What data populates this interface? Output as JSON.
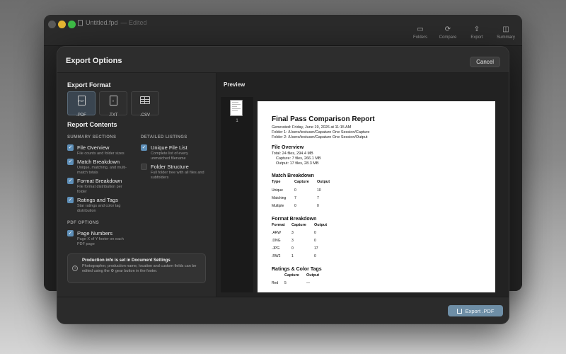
{
  "background_window": {
    "title": "Untitled.fpd",
    "edited": "— Edited",
    "toolbar": [
      {
        "label": "Folders",
        "icon": "folder-icon"
      },
      {
        "label": "Compare",
        "icon": "compare-icon"
      },
      {
        "label": "Export",
        "icon": "share-icon"
      },
      {
        "label": "Summary",
        "icon": "sidebar-icon"
      }
    ]
  },
  "dialog": {
    "title": "Export Options",
    "cancel_label": "Cancel",
    "export_format_heading": "Export Format",
    "formats": [
      {
        "label": ".PDF",
        "selected": true
      },
      {
        "label": ".TXT",
        "selected": false
      },
      {
        "label": ".CSV",
        "selected": false
      }
    ],
    "report_contents_heading": "Report Contents",
    "summary_sections_heading": "SUMMARY SECTIONS",
    "detailed_listings_heading": "DETAILED LISTINGS",
    "summary_sections": [
      {
        "label": "File Overview",
        "desc": "File counts and folder sizes",
        "checked": true
      },
      {
        "label": "Match Breakdown",
        "desc": "Unique, matching, and multi-match totals",
        "checked": true
      },
      {
        "label": "Format Breakdown",
        "desc": "File format distribution per folder",
        "checked": true
      },
      {
        "label": "Ratings and Tags",
        "desc": "Star ratings and color tag distribution",
        "checked": true
      }
    ],
    "detailed_listings": [
      {
        "label": "Unique File List",
        "desc": "Complete list of every unmatched filename",
        "checked": true
      },
      {
        "label": "Folder Structure",
        "desc": "Full folder tree with all files and subfolders",
        "checked": false
      }
    ],
    "pdf_options_heading": "PDF OPTIONS",
    "pdf_options": [
      {
        "label": "Page Numbers",
        "desc": "Page X of Y footer on each PDF page",
        "checked": true
      }
    ],
    "info": {
      "title": "Production info is set in Document Settings",
      "text": "Photographer, production name, location and custom fields can be edited using the ⚙ gear button in the footer."
    },
    "preview_label": "Preview",
    "thumbnail_page": "1",
    "export_label": "Export .PDF"
  },
  "report": {
    "title": "Final Pass Comparison Report",
    "generated": "Generated: Friday, June 19, 2026 at 11:15 AM",
    "folder1": "Folder 1: /Users/testuser/Capature One Session/Capture",
    "folder2": "Folder 2: /Users/testuser/Capature One Session/Output",
    "file_overview_heading": "File Overview",
    "total": "Total: 24 files, 294.4 MB",
    "capture": "Capture: 7 files, 266.1 MB",
    "output": "Output: 17 files, 28.3 MB",
    "match_heading": "Match Breakdown",
    "match_headers": [
      "Type",
      "Capture",
      "Output"
    ],
    "match_rows": [
      [
        "Unique",
        "0",
        "10"
      ],
      [
        "Matching",
        "7",
        "7"
      ],
      [
        "Multiple",
        "0",
        "0"
      ]
    ],
    "format_heading": "Format Breakdown",
    "format_headers": [
      "Format",
      "Capture",
      "Output"
    ],
    "format_rows": [
      [
        ".ARW",
        "3",
        "0"
      ],
      [
        ".DNG",
        "3",
        "0"
      ],
      [
        ".JPG",
        "0",
        "17"
      ],
      [
        ".RW2",
        "1",
        "0"
      ]
    ],
    "ratings_heading": "Ratings & Color Tags",
    "ratings_headers": [
      "Capture",
      "Output"
    ],
    "ratings_rows": [
      [
        "Red",
        "5",
        "—"
      ]
    ]
  }
}
